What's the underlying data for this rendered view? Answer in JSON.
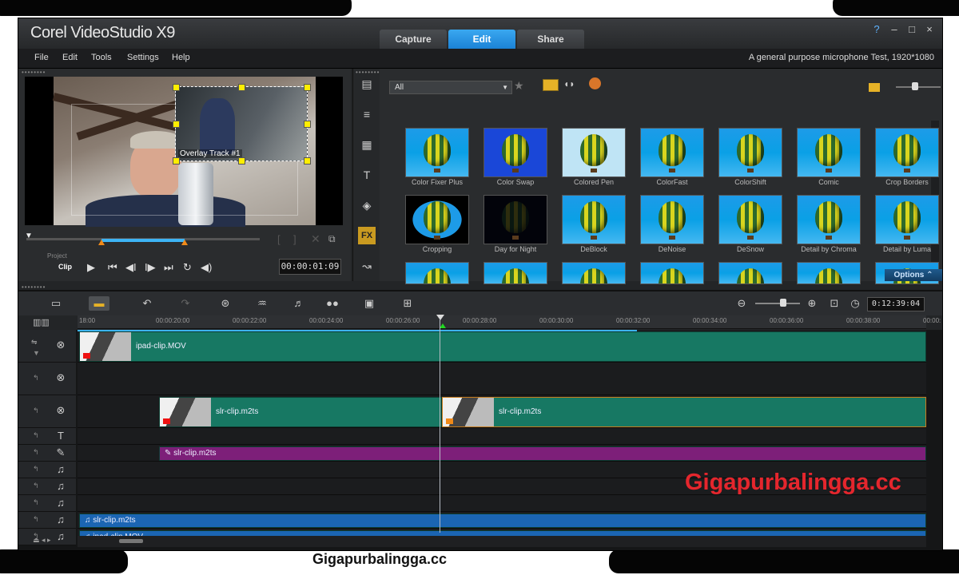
{
  "app": {
    "brand": "Corel VideoStudio X9",
    "tabs": [
      {
        "label": "Capture"
      },
      {
        "label": "Edit"
      },
      {
        "label": "Share"
      }
    ],
    "window_controls": [
      "?",
      "–",
      "□",
      "×"
    ],
    "menu": [
      "File",
      "Edit",
      "Tools",
      "Settings",
      "Help"
    ],
    "project_info": "A general purpose microphone Test, 1920*1080"
  },
  "preview": {
    "overlay_label": "Overlay Track #1",
    "mode_labels": [
      "Project",
      "Clip"
    ],
    "timecode": "00:00:01:09"
  },
  "library": {
    "filter_value": "All",
    "tool_fx_label": "FX",
    "options_label": "Options",
    "items": [
      {
        "label": "Color Fixer Plus"
      },
      {
        "label": "Color Swap"
      },
      {
        "label": "Colored Pen"
      },
      {
        "label": "ColorFast"
      },
      {
        "label": "ColorShift"
      },
      {
        "label": "Comic"
      },
      {
        "label": "Crop Borders"
      },
      {
        "label": "Cropping"
      },
      {
        "label": "Day for Night"
      },
      {
        "label": "DeBlock"
      },
      {
        "label": "DeNoise"
      },
      {
        "label": "DeSnow"
      },
      {
        "label": "Detail by Chroma"
      },
      {
        "label": "Detail by Luma"
      }
    ]
  },
  "timeline": {
    "project_duration": "0:12:39:04",
    "ruler": [
      "18:00",
      "00:00:20:00",
      "00:00:22:00",
      "00:00:24:00",
      "00:00:26:00",
      "00:00:28:00",
      "00:00:30:00",
      "00:00:32:00",
      "00:00:34:00",
      "00:00:36:00",
      "00:00:38:00",
      "00:00:"
    ],
    "clips": {
      "video_main": "ipad-clip.MOV",
      "overlay_a": "slr-clip.m2ts",
      "overlay_b": "slr-clip.m2ts",
      "title": "slr-clip.m2ts",
      "music_1": "slr-clip.m2ts",
      "music_2": "ipad-clip.MOV"
    }
  },
  "watermark": "Gigapurbalingga.cc",
  "caption": "Gigapurbalingga.cc"
}
